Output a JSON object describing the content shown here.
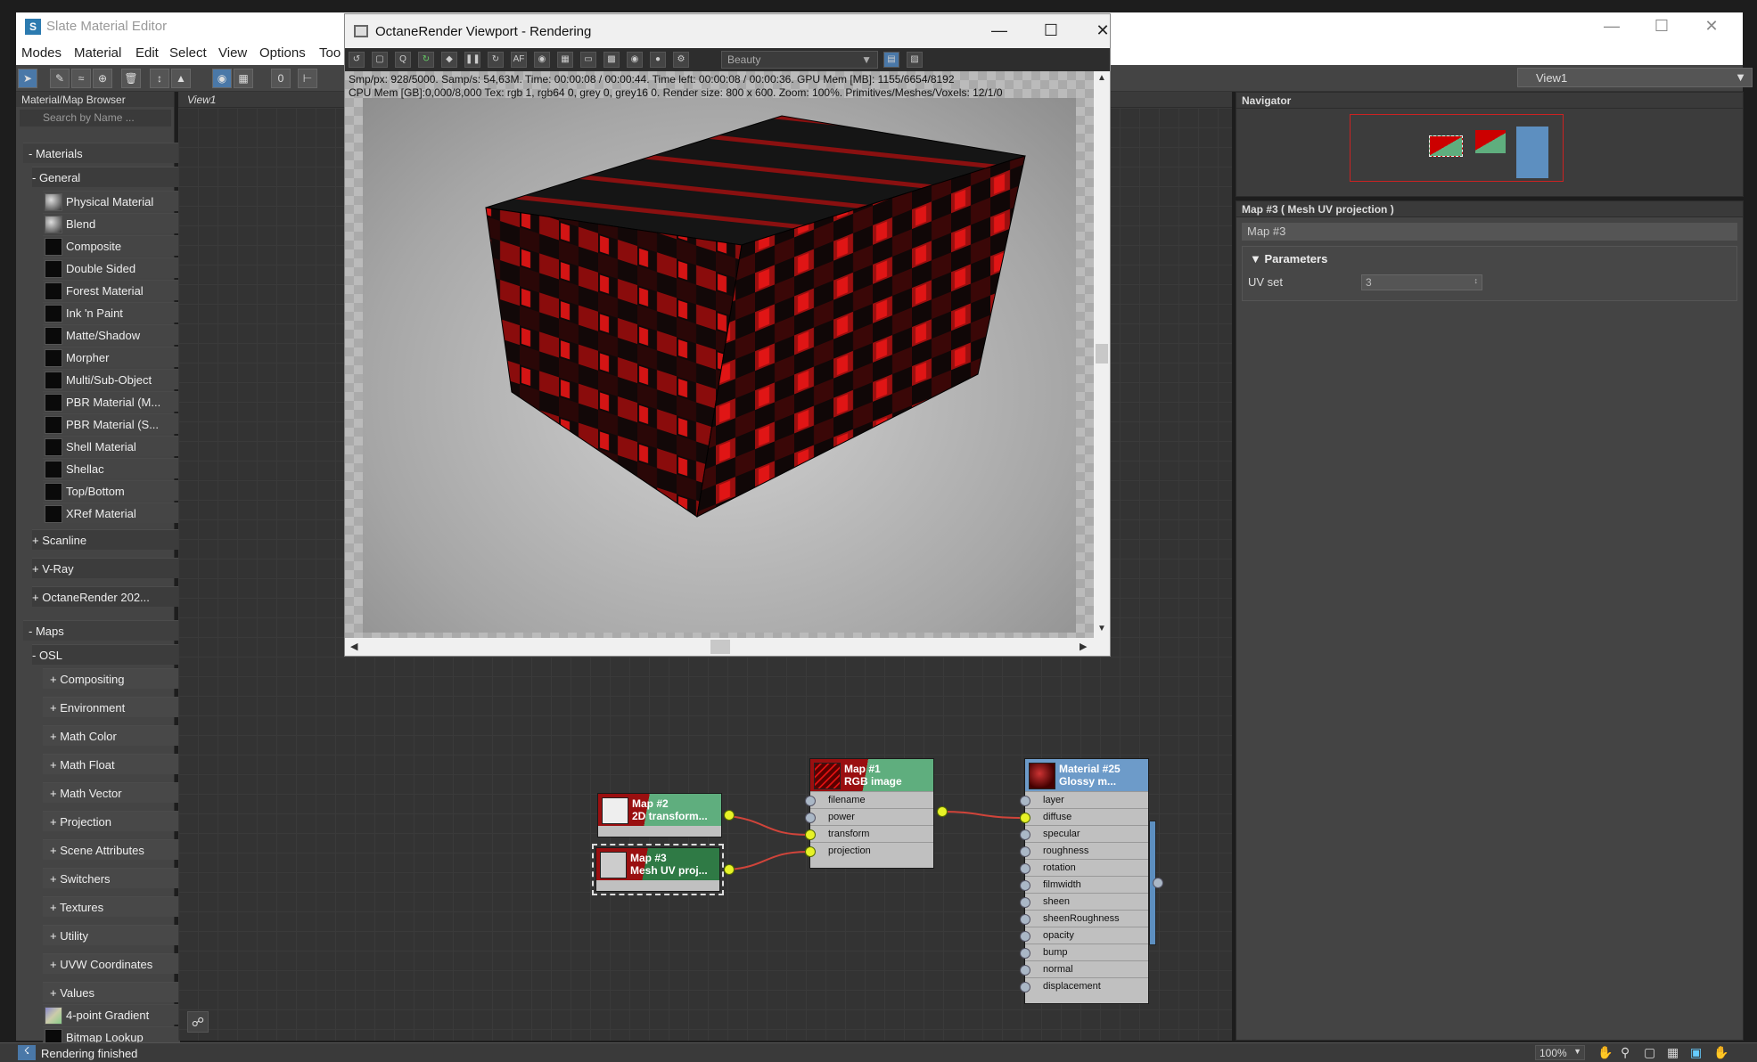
{
  "main": {
    "title": "Slate Material Editor",
    "menus": [
      "Modes",
      "Material",
      "Edit",
      "Select",
      "View",
      "Options",
      "Too"
    ],
    "view_selector": "View1",
    "view_tab": "View1"
  },
  "browser": {
    "title": "Material/Map Browser",
    "search_placeholder": "Search by Name ...",
    "materials_label": "- Materials",
    "general_label": "- General",
    "general_items": [
      "Physical Material",
      "Blend",
      "Composite",
      "Double Sided",
      "Forest Material",
      "Ink 'n Paint",
      "Matte/Shadow",
      "Morpher",
      "Multi/Sub-Object",
      "PBR Material (M...",
      "PBR Material (S...",
      "Shell Material",
      "Shellac",
      "Top/Bottom",
      "XRef Material"
    ],
    "collapsed_groups": [
      "+ Scanline",
      "+ V-Ray",
      "+ OctaneRender  202..."
    ],
    "maps_label": "- Maps",
    "osl_label": "- OSL",
    "osl_items": [
      "+ Compositing",
      "+ Environment",
      "+ Math Color",
      "+ Math Float",
      "+ Math Vector",
      "+ Projection",
      "+ Scene Attributes",
      "+ Switchers",
      "+ Textures",
      "+ Utility",
      "+ UVW Coordinates",
      "+ Values"
    ],
    "map_items": [
      "4-point Gradient",
      "Bitmap Lookup"
    ]
  },
  "navigator": {
    "title": "Navigator"
  },
  "properties": {
    "title": "Map #3  ( Mesh UV projection )",
    "map_name": "Map #3",
    "section": "Parameters",
    "uv_set_label": "UV set",
    "uv_set_value": "3"
  },
  "octane": {
    "title": "OctaneRender Viewport - Rendering",
    "pass": "Beauty",
    "stats_line1": "Smp/px: 928/5000.   Samp/s: 54,63M.   Time: 00:00:08 / 00:00:44.   Time left: 00:00:08 / 00:00:36.   GPU Mem [MB]: 1155/6654/8192",
    "stats_line2": "CPU Mem [GB]:0,000/8,000   Tex: rgb 1, rgb64 0, grey 0, grey16 0.   Render size: 800 x 600.   Zoom: 100%.   Primitives/Meshes/Voxels: 12/1/0"
  },
  "nodes": {
    "map2": {
      "line1": "Map #2",
      "line2": "2D transform..."
    },
    "map3": {
      "line1": "Map #3",
      "line2": "Mesh UV proj..."
    },
    "map1": {
      "line1": "Map #1",
      "line2": "RGB image",
      "slots": [
        "filename",
        "power",
        "transform",
        "projection"
      ]
    },
    "mat25": {
      "line1": "Material #25",
      "line2": "Glossy  m...",
      "slots": [
        "layer",
        "diffuse",
        "specular",
        "roughness",
        "rotation",
        "filmwidth",
        "sheen",
        "sheenRoughness",
        "opacity",
        "bump",
        "normal",
        "displacement"
      ]
    }
  },
  "status": {
    "message": "Rendering finished",
    "zoom": "100%"
  },
  "colors": {
    "node_green": "#5fae7e",
    "node_red": "#9a0f10",
    "node_blue": "#6d9bc9",
    "wire": "#d0443a",
    "socket_active": "#e7f227"
  }
}
